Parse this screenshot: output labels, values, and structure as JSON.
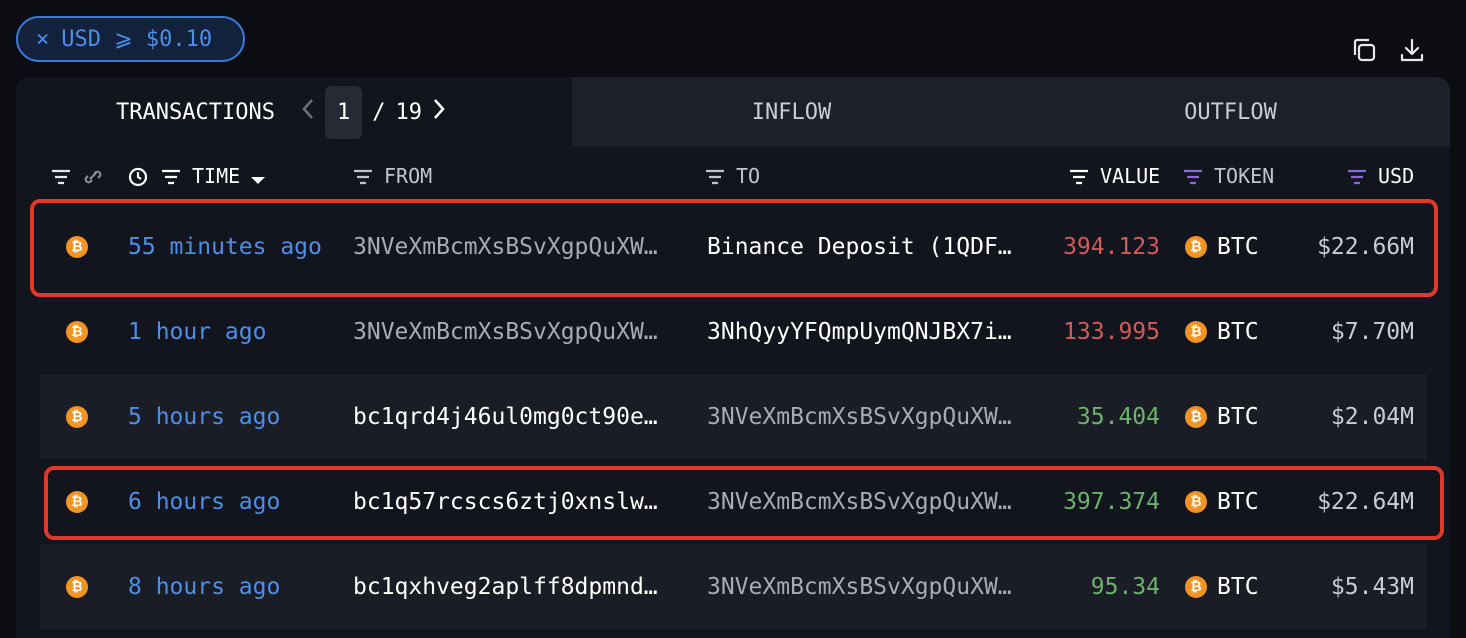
{
  "filter_chip": {
    "close": "×",
    "label": "USD ⩾ $0.10"
  },
  "top_icons": {
    "copy": "copy-icon",
    "download": "download-icon"
  },
  "tabs": {
    "transactions": "TRANSACTIONS",
    "page_current": "1",
    "page_separator": "/",
    "page_total": "19",
    "inflow": "INFLOW",
    "outflow": "OUTFLOW"
  },
  "columns": {
    "time": "TIME",
    "from": "FROM",
    "to": "TO",
    "value": "VALUE",
    "token": "TOKEN",
    "usd": "USD"
  },
  "rows": [
    {
      "time": "55 minutes ago",
      "from": "3NVeXmBcmXsBSvXgpQuXW…",
      "to": "Binance Deposit (1QDF…",
      "value": "394.123",
      "token": "BTC",
      "usd": "$22.66M"
    },
    {
      "time": "1 hour ago",
      "from": "3NVeXmBcmXsBSvXgpQuXW…",
      "to": "3NhQyyYFQmpUymQNJBX7i…",
      "value": "133.995",
      "token": "BTC",
      "usd": "$7.70M"
    },
    {
      "time": "5 hours ago",
      "from": "bc1qrd4j46ul0mg0ct90e…",
      "to": "3NVeXmBcmXsBSvXgpQuXW…",
      "value": "35.404",
      "token": "BTC",
      "usd": "$2.04M"
    },
    {
      "time": "6 hours ago",
      "from": "bc1q57rcscs6ztj0xnslw…",
      "to": "3NVeXmBcmXsBSvXgpQuXW…",
      "value": "397.374",
      "token": "BTC",
      "usd": "$22.64M"
    },
    {
      "time": "8 hours ago",
      "from": "bc1qxhveg2aplff8dpmnd…",
      "to": "3NVeXmBcmXsBSvXgpQuXW…",
      "value": "95.34",
      "token": "BTC",
      "usd": "$5.43M"
    }
  ],
  "coin_glyph": "₿",
  "colors": {
    "accent": "#4d8fe8",
    "outflow_value": "#d25a5a",
    "inflow_value": "#6bb36b",
    "highlight": "#e0392b",
    "btc": "#f39321"
  }
}
